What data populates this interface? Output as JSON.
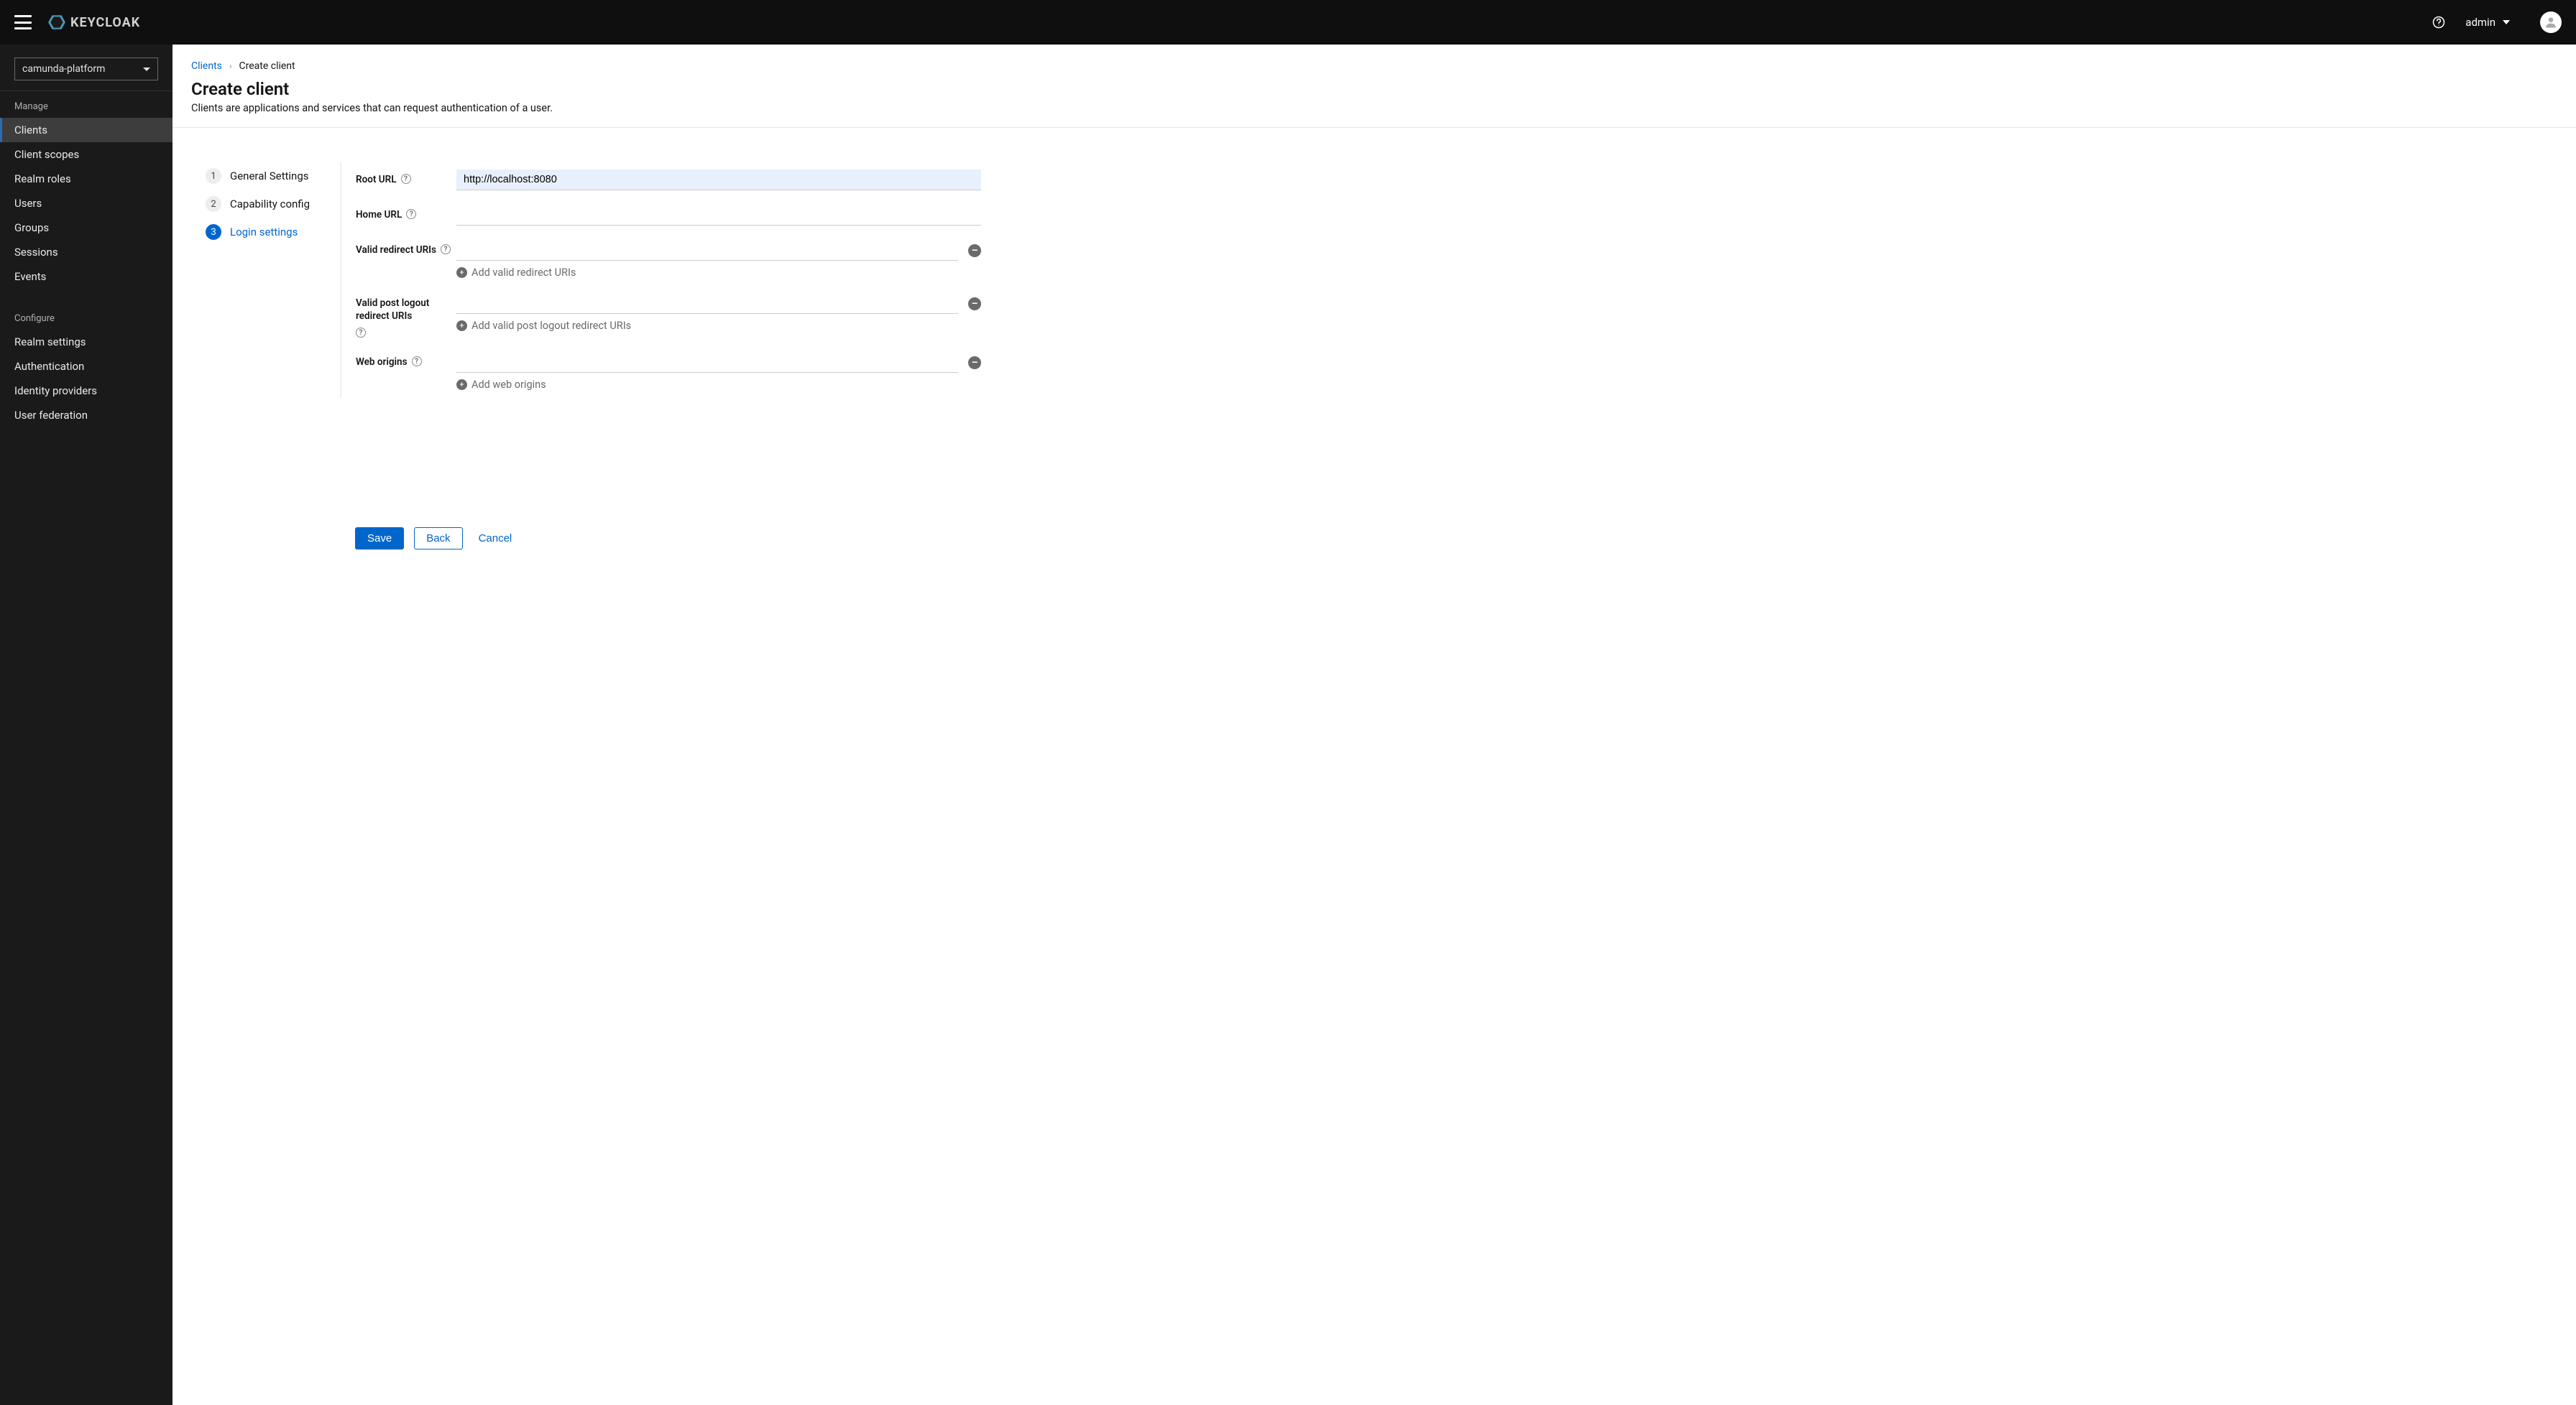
{
  "topbar": {
    "brand_text": "KEYCLOAK",
    "user_label": "admin"
  },
  "sidebar": {
    "realm_selected": "camunda-platform",
    "sections": {
      "manage_label": "Manage",
      "configure_label": "Configure"
    },
    "manage_items": [
      "Clients",
      "Client scopes",
      "Realm roles",
      "Users",
      "Groups",
      "Sessions",
      "Events"
    ],
    "configure_items": [
      "Realm settings",
      "Authentication",
      "Identity providers",
      "User federation"
    ],
    "active_item": "Clients"
  },
  "breadcrumb": {
    "root": "Clients",
    "current": "Create client"
  },
  "page": {
    "title": "Create client",
    "description": "Clients are applications and services that can request authentication of a user."
  },
  "wizard": {
    "steps": [
      {
        "num": "1",
        "label": "General Settings"
      },
      {
        "num": "2",
        "label": "Capability config"
      },
      {
        "num": "3",
        "label": "Login settings"
      }
    ],
    "active_step_index": 2
  },
  "form": {
    "root_url": {
      "label": "Root URL",
      "value": "http://localhost:8080"
    },
    "home_url": {
      "label": "Home URL",
      "value": ""
    },
    "valid_redirect": {
      "label": "Valid redirect URIs",
      "value": "",
      "add_text": "Add valid redirect URIs"
    },
    "valid_post_logout": {
      "label": "Valid post logout redirect URIs",
      "value": "",
      "add_text": "Add valid post logout redirect URIs"
    },
    "web_origins": {
      "label": "Web origins",
      "value": "",
      "add_text": "Add web origins"
    }
  },
  "buttons": {
    "save": "Save",
    "back": "Back",
    "cancel": "Cancel"
  }
}
